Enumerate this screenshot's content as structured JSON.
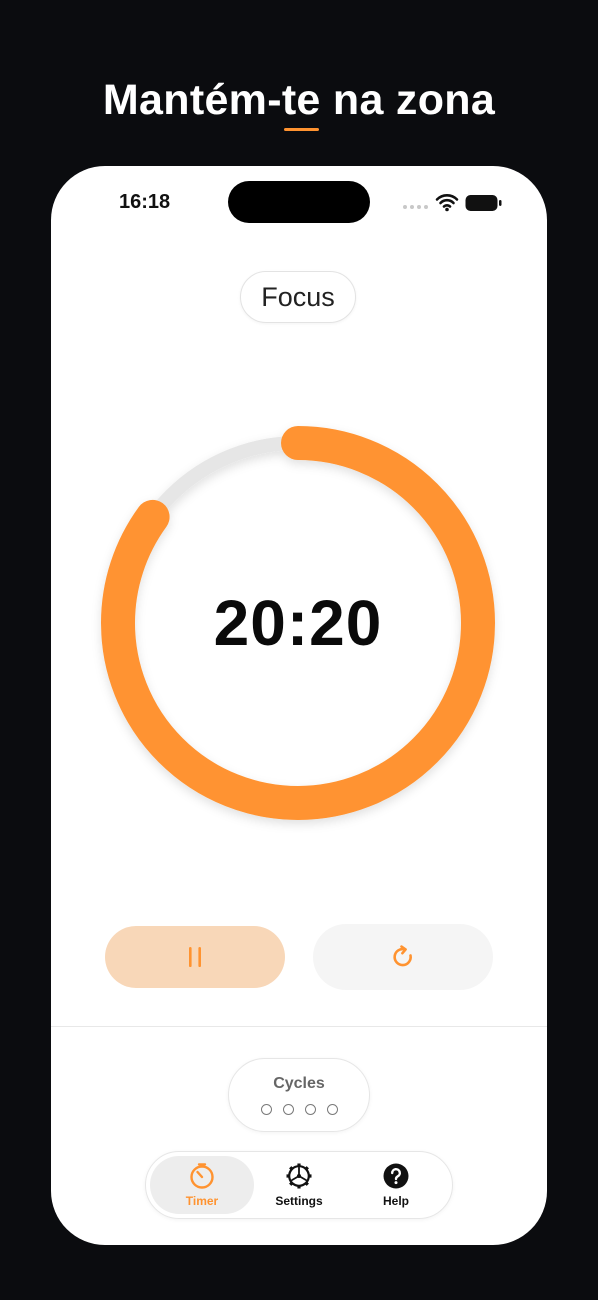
{
  "headline": {
    "before": "Mantém-",
    "underlined": "te",
    "after": " na zona"
  },
  "status_bar": {
    "time": "16:18"
  },
  "mode": {
    "label": "Focus"
  },
  "timer": {
    "display": "20:20",
    "progress_fraction": 0.85
  },
  "controls": {
    "pause_icon": "pause-icon",
    "reset_icon": "refresh-icon"
  },
  "cycles": {
    "label": "Cycles",
    "total": 4,
    "completed": 0
  },
  "tabs": [
    {
      "label": "Timer",
      "icon": "timer-icon",
      "active": true
    },
    {
      "label": "Settings",
      "icon": "gear-icon",
      "active": false
    },
    {
      "label": "Help",
      "icon": "help-icon",
      "active": false
    }
  ],
  "colors": {
    "accent": "#ff9330",
    "accent_soft": "#f8d7b8",
    "track": "#e6e6e6",
    "background": "#0b0c0f"
  }
}
